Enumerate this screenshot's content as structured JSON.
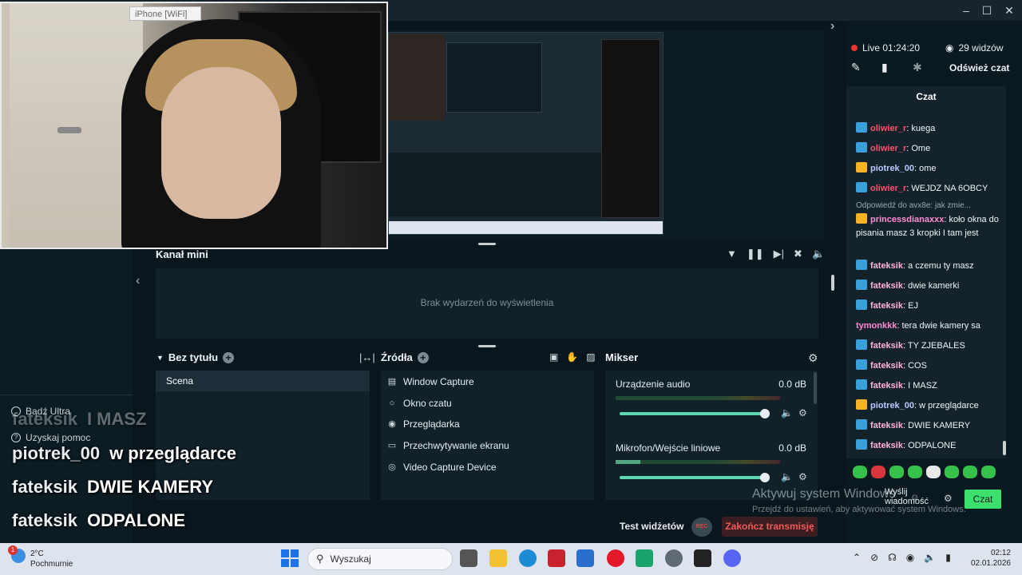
{
  "webcam": {
    "device_label": "iPhone [WiFi]"
  },
  "events": {
    "title": "Kanał mini",
    "empty_text": "Brak wydarzeń do wyświetlenia"
  },
  "scenes": {
    "title": "Bez tytułu",
    "items": [
      "Scena"
    ]
  },
  "sources": {
    "title": "Źródła",
    "items": [
      {
        "label": "Window Capture",
        "icon": "window-icon"
      },
      {
        "label": "Okno czatu",
        "icon": "chat-icon"
      },
      {
        "label": "Przeglądarka",
        "icon": "globe-icon"
      },
      {
        "label": "Przechwytywanie ekranu",
        "icon": "monitor-icon"
      },
      {
        "label": "Video Capture Device",
        "icon": "camera-icon"
      }
    ]
  },
  "mixer": {
    "title": "Mikser",
    "channels": [
      {
        "name": "Urządzenie audio",
        "db": "0.0 dB",
        "level": 0.0
      },
      {
        "name": "Mikrofon/Wejście liniowe",
        "db": "0.0 dB",
        "level": 0.15
      }
    ]
  },
  "sidebar": {
    "links": [
      "Bądź Ultra",
      "Uzyskaj pomoc"
    ]
  },
  "overlay_chat": [
    {
      "user": "fateksik",
      "text": "I MASZ"
    },
    {
      "user": "piotrek_00",
      "text": "w przeglądarce"
    },
    {
      "user": "fateksik",
      "text": "DWIE KAMERY"
    },
    {
      "user": "fateksik",
      "text": "ODPALONE"
    }
  ],
  "bottom": {
    "test_widgets": "Test widżetów",
    "rec": "REC",
    "end_stream": "Zakończ transmisję"
  },
  "stream": {
    "live_label": "Live 01:24:20",
    "viewers": "29 widzów",
    "refresh_chat": "Odśwież czat"
  },
  "chat": {
    "title": "Czat",
    "reply_preview": "Odpowiedź do avx8e: jak zmie...",
    "messages": [
      {
        "user": "oliwier_r",
        "text": "kuega",
        "color": "#ff4f6d",
        "badge": "prime"
      },
      {
        "user": "oliwier_r",
        "text": "Ome",
        "color": "#ff4f6d",
        "badge": "prime"
      },
      {
        "user": "piotrek_00",
        "text": "ome",
        "color": "#b7c9ff",
        "badge": "crown"
      },
      {
        "user": "oliwier_r",
        "text": "WEJDZ NA 6OBCY",
        "color": "#ff4f6d",
        "badge": "prime"
      },
      {
        "user": "princessdianaxxx",
        "text": "koło okna do pisania masz 3 kropki I tam jest",
        "color": "#ff8ad1",
        "badge": "crown"
      },
      {
        "user": "fateksik",
        "text": "a czemu ty masz",
        "color": "#ffb3d9",
        "badge": "prime"
      },
      {
        "user": "fateksik",
        "text": "dwie kamerki",
        "color": "#ffb3d9",
        "badge": "prime"
      },
      {
        "user": "fateksik",
        "text": "EJ",
        "color": "#ffb3d9",
        "badge": "prime"
      },
      {
        "user": "tymonkkk",
        "text": "tera dwie kamery sa",
        "color": "#ff8ad1",
        "badge": "none"
      },
      {
        "user": "fateksik",
        "text": "TY ZJEBALES",
        "color": "#ffb3d9",
        "badge": "prime"
      },
      {
        "user": "fateksik",
        "text": "COS",
        "color": "#ffb3d9",
        "badge": "prime"
      },
      {
        "user": "fateksik",
        "text": "I MASZ",
        "color": "#ffb3d9",
        "badge": "prime"
      },
      {
        "user": "piotrek_00",
        "text": "w przeglądarce",
        "color": "#b7c9ff",
        "badge": "crown"
      },
      {
        "user": "fateksik",
        "text": "DWIE KAMERY",
        "color": "#ffb3d9",
        "badge": "prime"
      },
      {
        "user": "fateksik",
        "text": "ODPALONE",
        "color": "#ffb3d9",
        "badge": "prime"
      }
    ],
    "send_label": "Wyślij wiadomość",
    "chat_button": "Czat"
  },
  "watermark": {
    "line1": "Aktywuj system Windows",
    "line2": "Przejdź do ustawień, aby aktywować system Windows."
  },
  "taskbar": {
    "weather_temp": "2°C",
    "weather_desc": "Pochmurnie",
    "weather_badge": "1",
    "search_placeholder": "Wyszukaj",
    "time": "02:12",
    "date": "02.01.2026"
  },
  "colors": {
    "accent_green": "#3be06d",
    "live_red": "#e33333",
    "end_stream_red": "#f25a5a"
  }
}
